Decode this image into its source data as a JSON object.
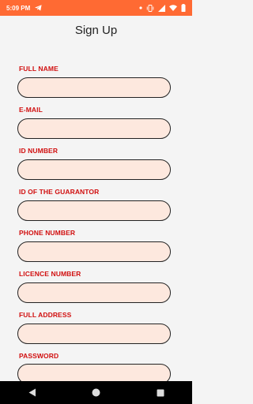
{
  "status_bar": {
    "time": "5:09 PM",
    "icons": [
      "telegram-icon",
      "dot-icon",
      "vibrate-icon",
      "signal-icon",
      "wifi-icon",
      "battery-icon"
    ]
  },
  "page": {
    "title": "Sign Up"
  },
  "form": {
    "fields": [
      {
        "label": "FULL NAME",
        "value": ""
      },
      {
        "label": "E-MAIL",
        "value": ""
      },
      {
        "label": "ID NUMBER",
        "value": ""
      },
      {
        "label": "ID OF THE GUARANTOR",
        "value": ""
      },
      {
        "label": "PHONE NUMBER",
        "value": ""
      },
      {
        "label": "LICENCE NUMBER",
        "value": ""
      },
      {
        "label": "FULL ADDRESS",
        "value": ""
      },
      {
        "label": "PASSWORD",
        "value": ""
      }
    ]
  },
  "nav_bar": {
    "icons": [
      "back-icon",
      "home-icon",
      "recents-icon"
    ]
  },
  "colors": {
    "status_bar": "#ff6a33",
    "label": "#d10f0f",
    "input_fill": "#fde8de",
    "background": "#f4f4f4"
  }
}
